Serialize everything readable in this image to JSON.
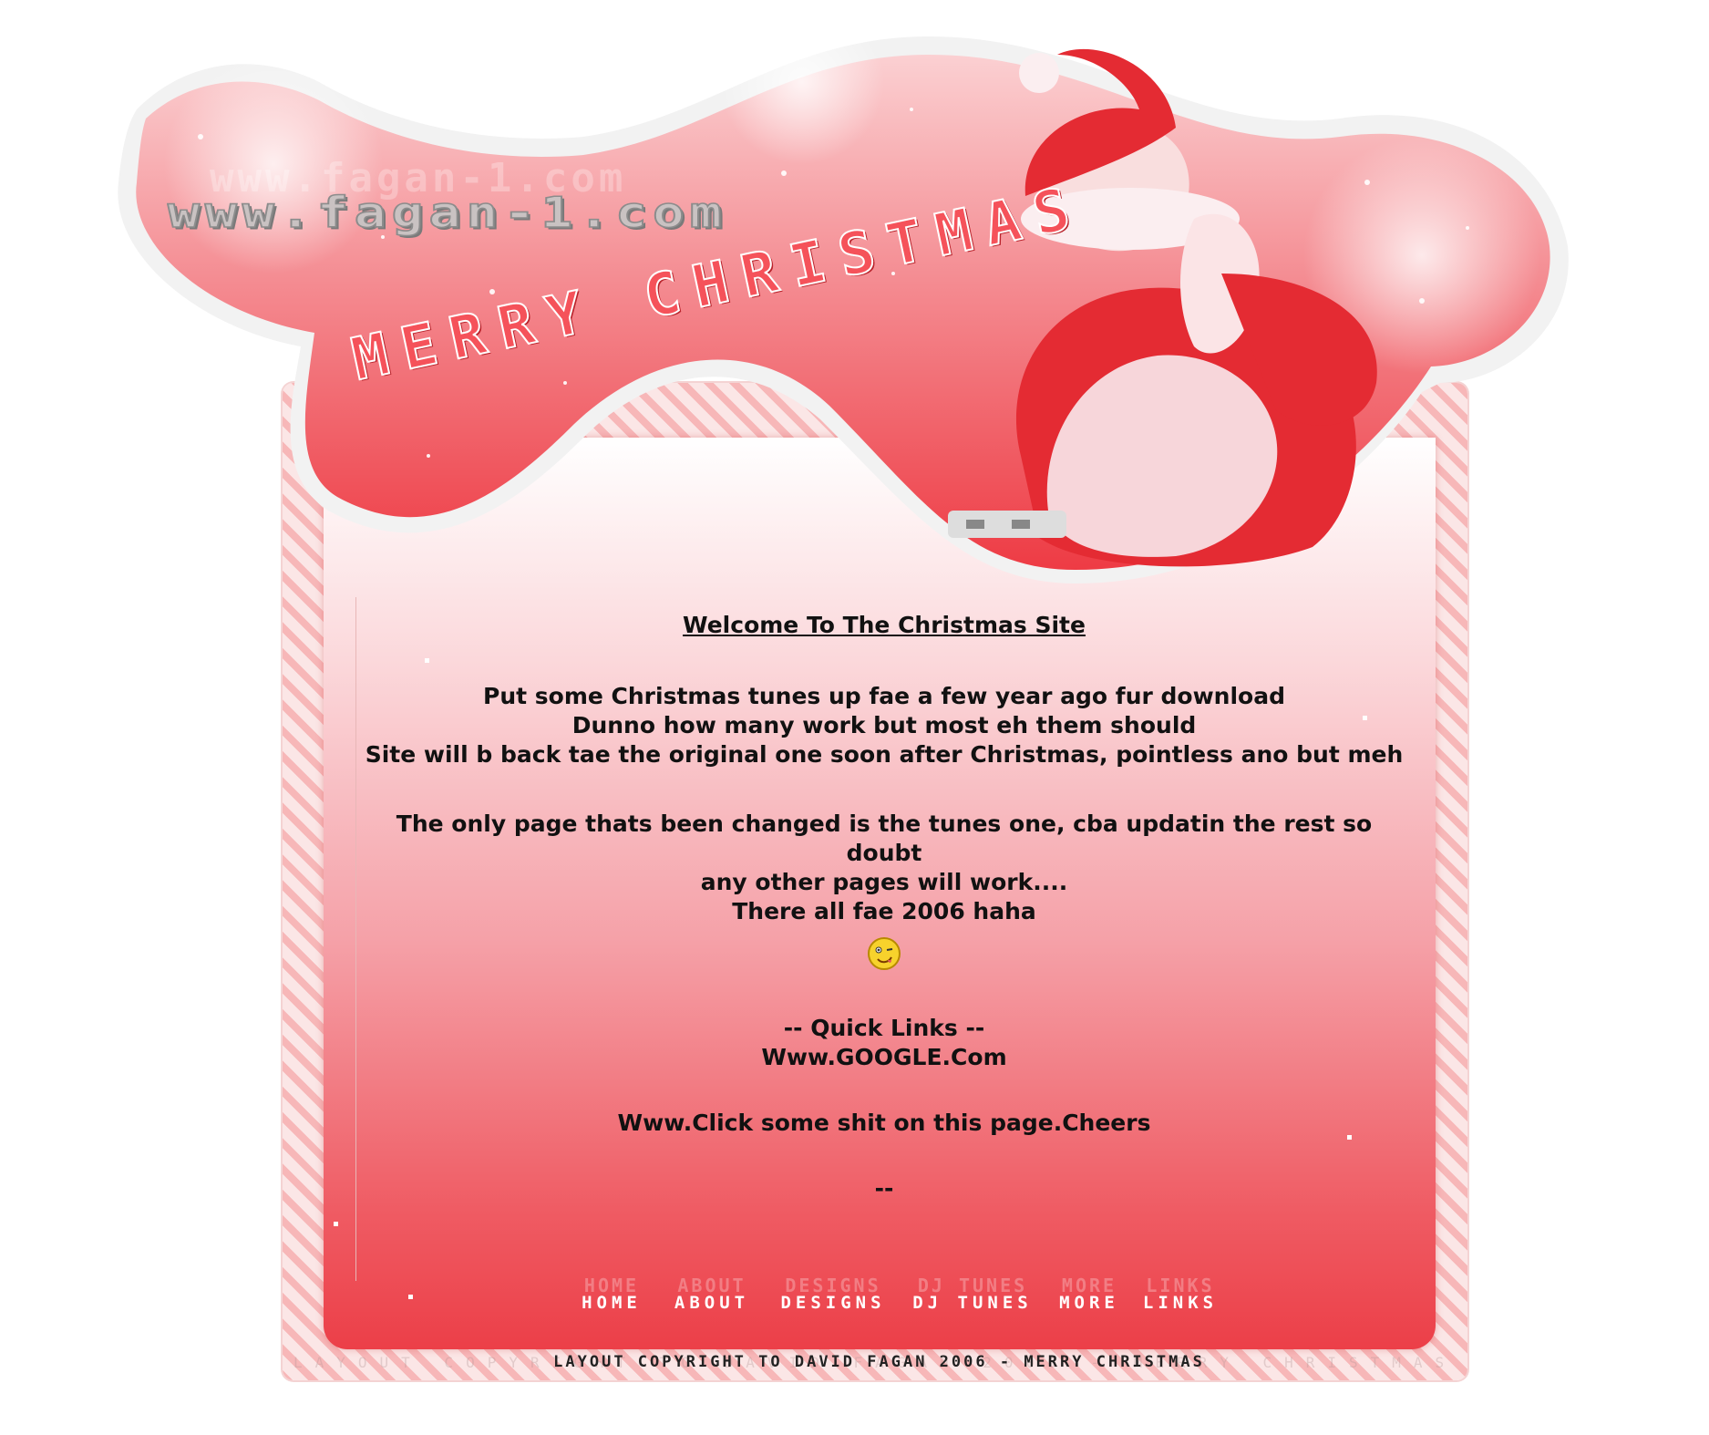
{
  "header": {
    "site_url": "www.fagan-1.com",
    "banner_text": "MERRY CHRISTMAS"
  },
  "main": {
    "title": "Welcome To The Christmas Site",
    "para1": [
      "Put some Christmas tunes up fae a few year ago fur download",
      "Dunno how many work but most eh them should",
      "Site will b back tae the original one soon after Christmas, pointless ano but meh"
    ],
    "para2": [
      "The only page thats been changed is the tunes one, cba updatin the rest so doubt",
      "any other pages will work....",
      "There all fae 2006 haha"
    ],
    "smiley_icon": "winking-smiley-icon",
    "quick_links_heading": "-- Quick Links --",
    "links": [
      "Www.GOOGLE.Com",
      "Www.Click some shit on this page.Cheers"
    ],
    "end_marker": "--"
  },
  "nav": {
    "items": [
      "HOME",
      "ABOUT",
      "DESIGNS",
      "DJ TUNES",
      "MORE",
      "LINKS"
    ],
    "ghost_items": [
      "HOME",
      "ABOUT",
      "DESIGNS",
      "DJ TUNES",
      "MORE",
      "LINKS"
    ]
  },
  "footer": {
    "copyright": "LAYOUT COPYRIGHT TO DAVID FAGAN 2006 - MERRY CHRISTMAS"
  },
  "colors": {
    "accent_red": "#ec3f48",
    "banner_pink": "#f7a3a6",
    "text": "#111111"
  }
}
